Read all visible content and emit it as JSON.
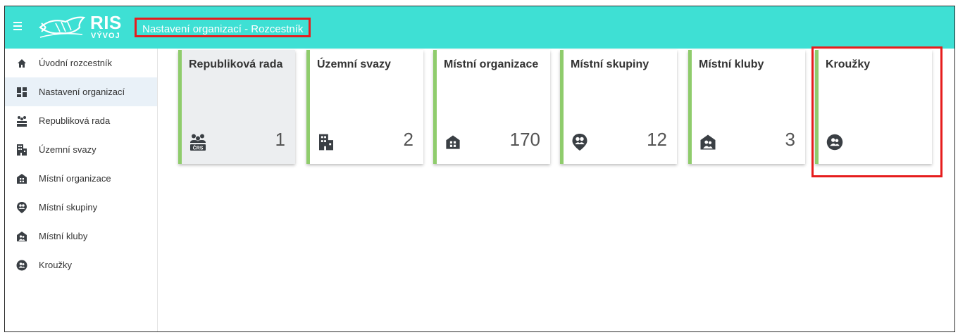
{
  "header": {
    "logo_main": "RIS",
    "logo_sub": "VÝVOJ",
    "page_title": "Nastavení organizací - Rozcestník"
  },
  "sidebar": {
    "items": [
      {
        "label": "Úvodní rozcestník",
        "icon": "home-icon"
      },
      {
        "label": "Nastavení organizací",
        "icon": "dashboard-icon",
        "active": true
      },
      {
        "label": "Republiková rada",
        "icon": "group-crs-icon"
      },
      {
        "label": "Územní svazy",
        "icon": "building-icon"
      },
      {
        "label": "Místní organizace",
        "icon": "house-icon"
      },
      {
        "label": "Místní skupiny",
        "icon": "group-pin-icon"
      },
      {
        "label": "Místní kluby",
        "icon": "club-icon"
      },
      {
        "label": "Kroužky",
        "icon": "circle-group-icon"
      }
    ]
  },
  "cards": [
    {
      "title": "Republiková rada",
      "count": "1",
      "icon": "group-crs-icon",
      "icon_text": "ČRS"
    },
    {
      "title": "Územní svazy",
      "count": "2",
      "icon": "building-icon"
    },
    {
      "title": "Místní organizace",
      "count": "170",
      "icon": "house-icon"
    },
    {
      "title": "Místní skupiny",
      "count": "12",
      "icon": "group-pin-icon"
    },
    {
      "title": "Místní kluby",
      "count": "3",
      "icon": "club-icon"
    },
    {
      "title": "Kroužky",
      "count": "",
      "icon": "circle-group-icon"
    }
  ],
  "colors": {
    "topbar": "#3ee0d4",
    "card_accent": "#8fcc6c",
    "highlight": "#e61d1d",
    "icon": "#3a3f44"
  }
}
